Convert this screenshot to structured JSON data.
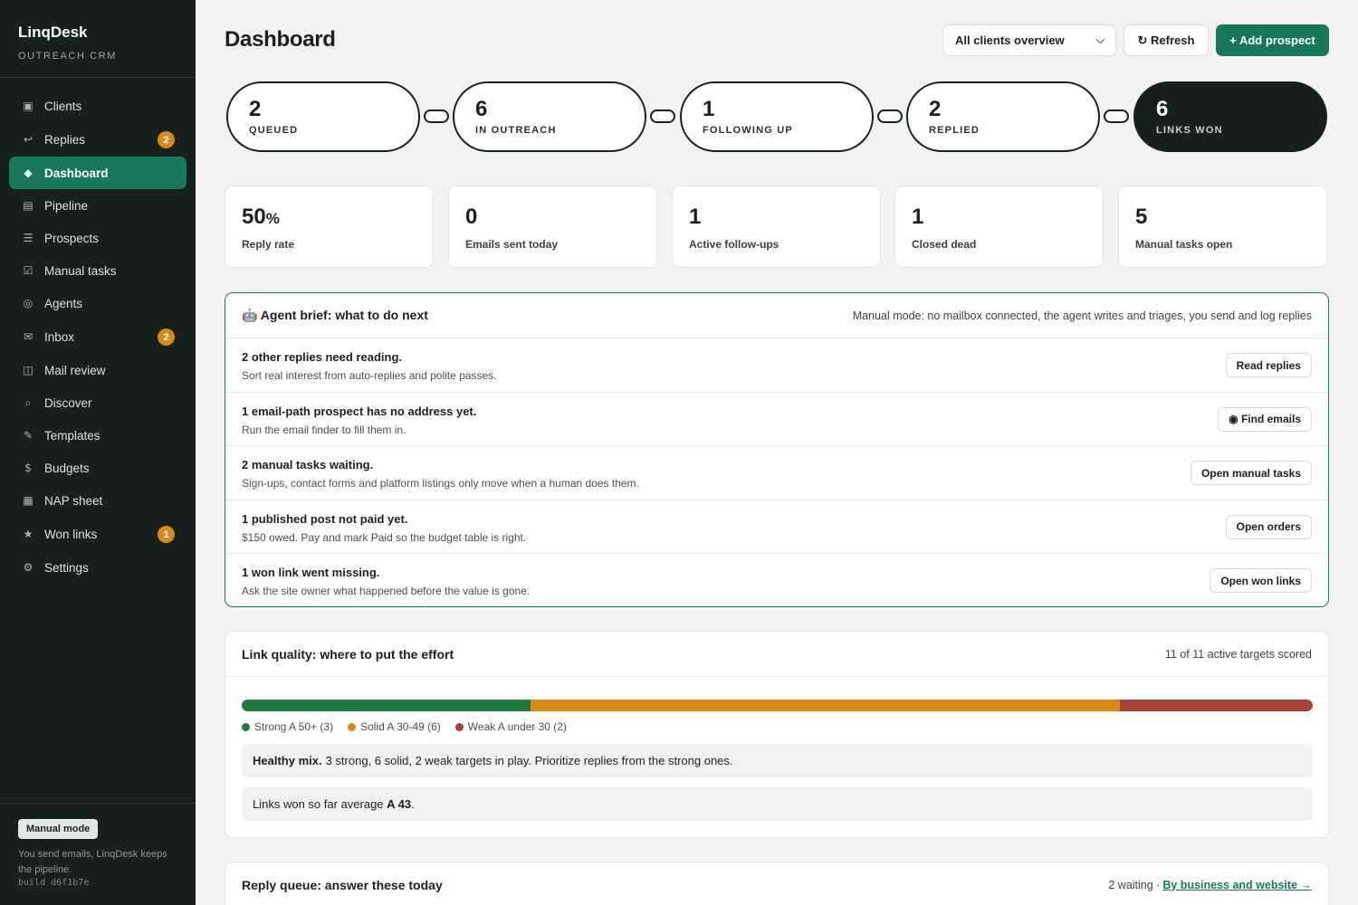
{
  "brand": {
    "name": "LinqDesk",
    "subtitle": "OUTREACH CRM"
  },
  "sidebar": {
    "items": [
      {
        "label": "Clients",
        "icon": "▣",
        "badge": null
      },
      {
        "label": "Replies",
        "icon": "↩",
        "badge": "2"
      },
      {
        "label": "Dashboard",
        "icon": "◆",
        "badge": null,
        "active": true
      },
      {
        "label": "Pipeline",
        "icon": "▤",
        "badge": null
      },
      {
        "label": "Prospects",
        "icon": "☰",
        "badge": null
      },
      {
        "label": "Manual tasks",
        "icon": "☑",
        "badge": null
      },
      {
        "label": "Agents",
        "icon": "◎",
        "badge": null
      },
      {
        "label": "Inbox",
        "icon": "✉",
        "badge": "2"
      },
      {
        "label": "Mail review",
        "icon": "◫",
        "badge": null
      },
      {
        "label": "Discover",
        "icon": "⌕",
        "badge": null
      },
      {
        "label": "Templates",
        "icon": "✎",
        "badge": null
      },
      {
        "label": "Budgets",
        "icon": "$",
        "badge": null
      },
      {
        "label": "NAP sheet",
        "icon": "▦",
        "badge": null
      },
      {
        "label": "Won links",
        "icon": "★",
        "badge": "1"
      },
      {
        "label": "Settings",
        "icon": "⚙",
        "badge": null
      }
    ],
    "footer": {
      "mode": "Manual mode",
      "text": "You send emails, LinqDesk keeps the pipeline.",
      "build": "build d6f1b7e"
    }
  },
  "header": {
    "title": "Dashboard",
    "client_select": "All clients overview",
    "refresh": "↻ Refresh",
    "add": "+ Add prospect"
  },
  "stages": [
    {
      "count": "2",
      "label": "QUEUED"
    },
    {
      "count": "6",
      "label": "IN OUTREACH"
    },
    {
      "count": "1",
      "label": "FOLLOWING UP"
    },
    {
      "count": "2",
      "label": "REPLIED"
    },
    {
      "count": "6",
      "label": "LINKS WON"
    }
  ],
  "stats": [
    {
      "value": "50",
      "unit": "%",
      "label": "Reply rate"
    },
    {
      "value": "0",
      "unit": "",
      "label": "Emails sent today"
    },
    {
      "value": "1",
      "unit": "",
      "label": "Active follow-ups"
    },
    {
      "value": "1",
      "unit": "",
      "label": "Closed dead"
    },
    {
      "value": "5",
      "unit": "",
      "label": "Manual tasks open"
    }
  ],
  "brief": {
    "title": "🤖 Agent brief: what to do next",
    "meta": "Manual mode: no mailbox connected, the agent writes and triages, you send and log replies",
    "rows": [
      {
        "title": "2 other replies need reading.",
        "sub": "Sort real interest from auto-replies and polite passes.",
        "button": "Read replies"
      },
      {
        "title": "1 email-path prospect has no address yet.",
        "sub": "Run the email finder to fill them in.",
        "button": "◉ Find emails"
      },
      {
        "title": "2 manual tasks waiting.",
        "sub": "Sign-ups, contact forms and platform listings only move when a human does them.",
        "button": "Open manual tasks"
      },
      {
        "title": "1 published post not paid yet.",
        "sub": "$150 owed. Pay and mark Paid so the budget table is right.",
        "button": "Open orders"
      },
      {
        "title": "1 won link went missing.",
        "sub": "Ask the site owner what happened before the value is gone.",
        "button": "Open won links"
      }
    ]
  },
  "quality": {
    "title": "Link quality: where to put the effort",
    "meta": "11 of 11 active targets scored",
    "segments": [
      {
        "label": "Strong A 50+ (3)",
        "fraction": 0.27,
        "color": "#1f7a3f"
      },
      {
        "label": "Solid A 30-49 (6)",
        "fraction": 0.55,
        "color": "#d8891c"
      },
      {
        "label": "Weak A under 30 (2)",
        "fraction": 0.18,
        "color": "#a8433a"
      }
    ],
    "note1_bold": "Healthy mix.",
    "note1_text": "3 strong, 6 solid, 2 weak targets in play. Prioritize replies from the strong ones.",
    "note2_text": "Links won so far average",
    "note2_bold": "A 43",
    "note2_end": "."
  },
  "queue": {
    "title": "Reply queue: answer these today",
    "meta": "2 waiting ·",
    "link": "By business and website →"
  }
}
